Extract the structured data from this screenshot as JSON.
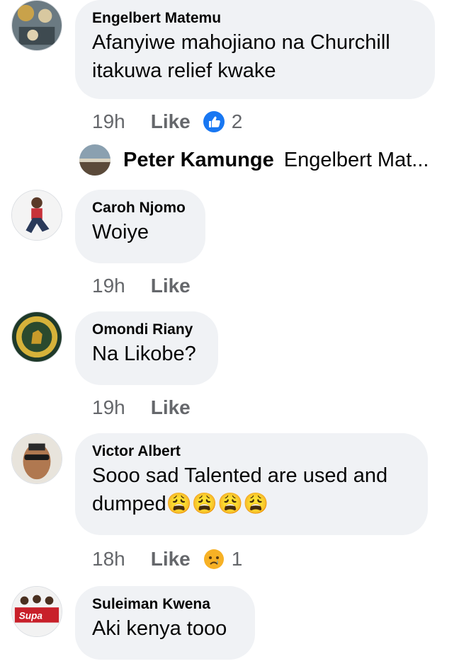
{
  "comments": [
    {
      "author": "Engelbert Matemu",
      "text_lines": [
        "Afanyiwe mahojiano na Churchill",
        "itakuwa relief kwake"
      ],
      "time": "19h",
      "like_label": "Like",
      "reaction_icon": "like-reaction-icon",
      "reaction_count": "2"
    },
    {
      "author": "Caroh Njomo",
      "text_lines": [
        "Woiye"
      ],
      "time": "19h",
      "like_label": "Like"
    },
    {
      "author": "Omondi Riany",
      "text_lines": [
        "Na Likobe?"
      ],
      "time": "19h",
      "like_label": "Like"
    },
    {
      "author": "Victor Albert",
      "text_lines": [
        "Sooo sad Talented are used and",
        "dumped😩😩😩😩"
      ],
      "time": "18h",
      "like_label": "Like",
      "reaction_icon": "sad-reaction-icon",
      "reaction_count": "1"
    },
    {
      "author": "Suleiman Kwena",
      "text_lines": [
        "Aki kenya tooo"
      ]
    }
  ],
  "reply_preview": {
    "author": "Peter Kamunge",
    "text": "Engelbert Mat..."
  },
  "colors": {
    "bubble": "#f0f2f5",
    "meta_text": "#65676b",
    "like_blue": "#1877f2",
    "sad_yellow": "#f7b125"
  }
}
